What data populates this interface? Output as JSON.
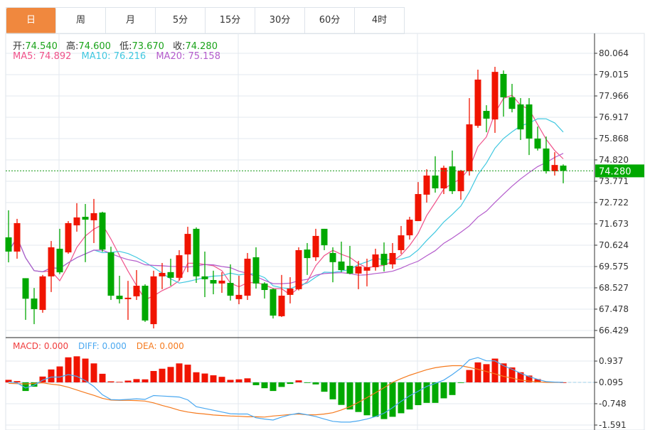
{
  "tabs": [
    "日",
    "周",
    "月",
    "5分",
    "15分",
    "30分",
    "60分",
    "4时"
  ],
  "active_tab": 0,
  "ohlc_info": {
    "open_label": "开:",
    "open": "74.540",
    "high_label": "高:",
    "high": "74.600",
    "low_label": "低:",
    "low": "73.670",
    "close_label": "收:",
    "close": "74.280"
  },
  "ma_info": {
    "ma5": "MA5: 74.892",
    "ma10": "MA10: 76.216",
    "ma20": "MA20: 75.158"
  },
  "macd_info": {
    "macd": "MACD: 0.000",
    "diff": "DIFF: 0.000",
    "dea": "DEA: 0.000"
  },
  "current_price": "74.280",
  "colors": {
    "up": "#f01400",
    "down": "#00a800",
    "ma5": "#f0528a",
    "ma10": "#40c8e0",
    "ma20": "#b45ccc",
    "diff": "#4aa8f0",
    "dea": "#f57a1e",
    "accent": "#f0883e"
  },
  "chart_data": [
    {
      "type": "candlestick",
      "title": "K线",
      "price_axis_labels": [
        "80.064",
        "79.015",
        "77.966",
        "76.917",
        "75.868",
        "74.820",
        "73.771",
        "72.722",
        "71.673",
        "70.624",
        "69.575",
        "68.527",
        "67.478",
        "66.429"
      ],
      "ylim": [
        66.429,
        80.064
      ],
      "candles": [
        [
          71.01,
          72.34,
          69.78,
          70.31
        ],
        [
          70.31,
          71.92,
          69.96,
          71.71
        ],
        [
          69.0,
          69.0,
          66.95,
          67.99
        ],
        [
          68.0,
          68.52,
          66.74,
          67.48
        ],
        [
          67.44,
          69.16,
          67.3,
          69.09
        ],
        [
          69.09,
          70.83,
          68.32,
          70.52
        ],
        [
          70.45,
          71.43,
          69.2,
          69.29
        ],
        [
          70.27,
          71.81,
          70.2,
          71.71
        ],
        [
          71.6,
          72.69,
          71.29,
          71.99
        ],
        [
          72.02,
          72.65,
          69.79,
          71.88
        ],
        [
          71.85,
          72.9,
          70.73,
          72.2
        ],
        [
          72.23,
          72.27,
          70.3,
          70.41
        ],
        [
          70.27,
          70.55,
          67.93,
          68.14
        ],
        [
          68.14,
          69.12,
          67.76,
          67.97
        ],
        [
          67.97,
          68.87,
          66.95,
          68.04
        ],
        [
          68.11,
          69.4,
          67.93,
          68.63
        ],
        [
          68.63,
          68.7,
          66.85,
          66.92
        ],
        [
          66.74,
          69.37,
          66.53,
          69.09
        ],
        [
          69.09,
          69.75,
          68.46,
          69.26
        ],
        [
          69.3,
          69.96,
          68.63,
          69.02
        ],
        [
          69.02,
          70.38,
          68.9,
          70.13
        ],
        [
          70.17,
          71.53,
          69.3,
          71.18
        ],
        [
          71.43,
          71.5,
          68.77,
          69.09
        ],
        [
          69.09,
          70.31,
          68.07,
          68.95
        ],
        [
          68.91,
          69.37,
          68.21,
          68.74
        ],
        [
          68.74,
          69.3,
          68.28,
          68.88
        ],
        [
          68.77,
          69.68,
          67.9,
          68.14
        ],
        [
          67.97,
          69.12,
          67.72,
          68.18
        ],
        [
          68.14,
          70.24,
          67.93,
          69.96
        ],
        [
          70.03,
          70.52,
          68.49,
          68.74
        ],
        [
          68.74,
          68.8,
          68.0,
          68.42
        ],
        [
          68.46,
          68.5,
          67.02,
          67.16
        ],
        [
          67.13,
          69.16,
          67.09,
          68.14
        ],
        [
          68.18,
          69.05,
          67.76,
          68.49
        ],
        [
          68.46,
          70.52,
          68.4,
          70.38
        ],
        [
          70.41,
          70.73,
          69.16,
          69.99
        ],
        [
          70.03,
          71.43,
          69.85,
          71.08
        ],
        [
          71.43,
          71.43,
          70.38,
          70.62
        ],
        [
          70.24,
          70.52,
          68.8,
          69.79
        ],
        [
          69.82,
          70.8,
          69.3,
          69.4
        ],
        [
          69.61,
          70.59,
          69.19,
          69.23
        ],
        [
          69.23,
          69.85,
          68.46,
          69.58
        ],
        [
          69.37,
          69.96,
          68.6,
          69.54
        ],
        [
          69.54,
          70.45,
          69.37,
          70.17
        ],
        [
          70.2,
          70.76,
          69.33,
          69.65
        ],
        [
          69.68,
          70.73,
          69.47,
          70.24
        ],
        [
          70.38,
          71.57,
          70.2,
          71.11
        ],
        [
          71.11,
          72.02,
          70.9,
          71.88
        ],
        [
          71.81,
          73.73,
          71.81,
          73.14
        ],
        [
          73.11,
          74.36,
          72.72,
          74.05
        ],
        [
          74.05,
          75.0,
          73.21,
          73.42
        ],
        [
          73.42,
          74.54,
          73.14,
          74.43
        ],
        [
          74.5,
          75.28,
          73.14,
          73.28
        ],
        [
          73.28,
          74.33,
          72.86,
          74.29
        ],
        [
          74.26,
          77.86,
          74.05,
          76.57
        ],
        [
          76.5,
          79.26,
          76.4,
          78.77
        ],
        [
          77.23,
          77.51,
          76.18,
          76.85
        ],
        [
          76.81,
          79.4,
          76.15,
          79.15
        ],
        [
          79.05,
          79.22,
          76.95,
          77.9
        ],
        [
          77.9,
          78.56,
          77.16,
          77.33
        ],
        [
          77.55,
          77.86,
          75.8,
          76.32
        ],
        [
          77.55,
          77.86,
          75.06,
          75.87
        ],
        [
          75.87,
          76.46,
          75.28,
          75.38
        ],
        [
          75.38,
          75.97,
          74.15,
          74.26
        ],
        [
          74.26,
          75.2,
          74.05,
          74.57
        ],
        [
          74.54,
          74.6,
          73.67,
          74.28
        ]
      ],
      "ma_periods": [
        5,
        10,
        20
      ]
    },
    {
      "type": "bar",
      "title": "MACD",
      "axis_labels": [
        "0.937",
        "0.095",
        "-0.748",
        "-1.591"
      ],
      "baseline_label": "0.095",
      "histogram": [
        0.1,
        0.05,
        -0.34,
        -0.17,
        0.23,
        0.51,
        0.63,
        0.99,
        1.03,
        0.94,
        0.75,
        0.34,
        0.04,
        0.02,
        0.07,
        0.13,
        0.12,
        0.45,
        0.54,
        0.61,
        0.75,
        0.7,
        0.4,
        0.35,
        0.28,
        0.22,
        0.1,
        0.12,
        0.16,
        -0.11,
        -0.23,
        -0.34,
        -0.18,
        -0.06,
        0.08,
        -0.01,
        -0.08,
        -0.37,
        -0.67,
        -0.89,
        -1.07,
        -1.17,
        -1.3,
        -1.36,
        -1.45,
        -1.36,
        -1.22,
        -1.07,
        -0.9,
        -0.81,
        -0.81,
        -0.63,
        -0.5,
        -0.01,
        0.49,
        0.79,
        0.72,
        0.94,
        0.75,
        0.59,
        0.4,
        0.27,
        0.13,
        0.02,
        0.02,
        0.0
      ],
      "diff": [
        0.02,
        -0.02,
        -0.22,
        -0.11,
        0.09,
        0.21,
        0.21,
        0.31,
        0.24,
        0.07,
        -0.16,
        -0.49,
        -0.68,
        -0.69,
        -0.67,
        -0.65,
        -0.67,
        -0.52,
        -0.54,
        -0.56,
        -0.58,
        -0.69,
        -0.96,
        -1.03,
        -1.1,
        -1.17,
        -1.24,
        -1.25,
        -1.25,
        -1.4,
        -1.45,
        -1.49,
        -1.37,
        -1.28,
        -1.22,
        -1.28,
        -1.35,
        -1.45,
        -1.54,
        -1.57,
        -1.57,
        -1.52,
        -1.45,
        -1.35,
        -1.22,
        -1.0,
        -0.75,
        -0.53,
        -0.35,
        -0.16,
        -0.04,
        0.09,
        0.31,
        0.56,
        0.89,
        0.98,
        0.85,
        0.85,
        0.66,
        0.52,
        0.36,
        0.23,
        0.12,
        0.03,
        0.01,
        0.0
      ],
      "dea": [
        -0.04,
        -0.05,
        -0.06,
        -0.04,
        -0.02,
        -0.07,
        -0.11,
        -0.19,
        -0.3,
        -0.41,
        -0.51,
        -0.63,
        -0.7,
        -0.71,
        -0.71,
        -0.72,
        -0.74,
        -0.81,
        -0.91,
        -1.0,
        -1.1,
        -1.17,
        -1.22,
        -1.25,
        -1.29,
        -1.31,
        -1.33,
        -1.34,
        -1.36,
        -1.36,
        -1.37,
        -1.33,
        -1.3,
        -1.27,
        -1.25,
        -1.28,
        -1.28,
        -1.25,
        -1.2,
        -1.09,
        -0.96,
        -0.79,
        -0.6,
        -0.41,
        -0.21,
        0.0,
        0.15,
        0.28,
        0.39,
        0.5,
        0.58,
        0.63,
        0.66,
        0.66,
        0.59,
        0.52,
        0.43,
        0.34,
        0.24,
        0.17,
        0.09,
        0.05,
        0.02,
        0.0,
        0.0,
        0.0
      ]
    }
  ]
}
